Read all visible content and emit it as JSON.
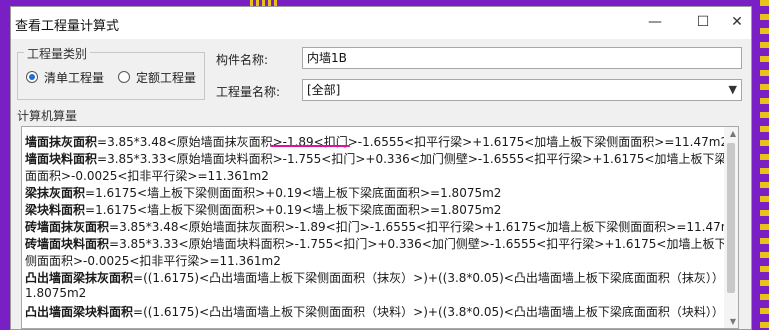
{
  "window": {
    "title": "查看工程量计算式",
    "controls": {
      "minimize": "—",
      "maximize": "☐",
      "close": "✕"
    }
  },
  "quantity_type": {
    "legend": "工程量类别",
    "options": [
      {
        "label": "清单工程量",
        "checked": true
      },
      {
        "label": "定额工程量",
        "checked": false
      }
    ]
  },
  "component": {
    "label": "构件名称:",
    "value": "内墙1B"
  },
  "quantity_name": {
    "label": "工程量名称:",
    "value": "[全部]"
  },
  "calc": {
    "legend": "计算机算量",
    "lines": [
      {
        "name": "墙面抹灰面积",
        "expr": "=3.85*3.48<原始墙面抹灰面积>-1.89<扣门>-1.6555<扣平行梁>+1.6175<加墙上板下梁侧面面积>=11.47m2"
      },
      {
        "name": "墙面块料面积",
        "expr": "=3.85*3.33<原始墙面块料面积>-1.755<扣门>+0.336<加门侧壁>-1.6555<扣平行梁>+1.6175<加墙上板下梁侧"
      },
      {
        "name": "",
        "expr": "面面积>-0.0025<扣非平行梁>=11.361m2"
      },
      {
        "name": "梁抹灰面积",
        "expr": "=1.6175<墙上板下梁侧面面积>+0.19<墙上板下梁底面面积>=1.8075m2"
      },
      {
        "name": "梁块料面积",
        "expr": "=1.6175<墙上板下梁侧面面积>+0.19<墙上板下梁底面面积>=1.8075m2"
      },
      {
        "name": "砖墙面抹灰面积",
        "expr": "=3.85*3.48<原始墙面抹灰面积>-1.89<扣门>-1.6555<扣平行梁>+1.6175<加墙上板下梁侧面面积>=11.47m2"
      },
      {
        "name": "砖墙面块料面积",
        "expr": "=3.85*3.33<原始墙面块料面积>-1.755<扣门>+0.336<加门侧壁>-1.6555<扣平行梁>+1.6175<加墙上板下梁"
      },
      {
        "name": "",
        "expr": "侧面面积>-0.0025<扣非平行梁>=11.361m2"
      },
      {
        "name": "凸出墙面梁抹灰面积",
        "expr": "=((1.6175)<凸出墙面墙上板下梁侧面面积（抹灰）>)+((3.8*0.05)<凸出墙面墙上板下梁底面面积（抹灰））>)="
      },
      {
        "name": "",
        "expr": "1.8075m2"
      },
      {
        "name": "凸出墙面梁块料面积",
        "expr": "=((1.6175)<凸出墙面墙上板下梁侧面面积（块料）>)+((3.8*0.05)<凸出墙面墙上板下梁底面面积（块料））>)="
      }
    ]
  },
  "colors": {
    "accent": "#1f6fd1",
    "highlight_underline": "#e0129a",
    "desktop": "#7a1fc4"
  }
}
